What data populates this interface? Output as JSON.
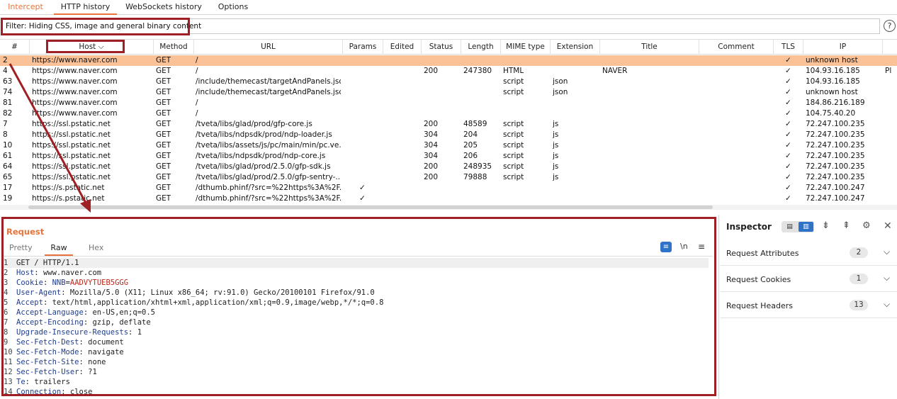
{
  "tabs": [
    {
      "label": "Intercept"
    },
    {
      "label": "HTTP history"
    },
    {
      "label": "WebSockets history"
    },
    {
      "label": "Options"
    }
  ],
  "filter": {
    "text": "Filter: Hiding CSS, image and general binary content",
    "help": "?"
  },
  "columns": {
    "num": "#",
    "host": "Host",
    "method": "Method",
    "url": "URL",
    "params": "Params",
    "edited": "Edited",
    "status": "Status",
    "length": "Length",
    "mime": "MIME type",
    "extension": "Extension",
    "title": "Title",
    "comment": "Comment",
    "tls": "TLS",
    "ip": "IP"
  },
  "rows": [
    {
      "num": "2",
      "host": "https://www.naver.com",
      "method": "GET",
      "url": "/",
      "params": "",
      "status": "",
      "length": "",
      "mime": "",
      "ext": "",
      "title": "",
      "tls": "✓",
      "ip": "unknown host",
      "extra": ""
    },
    {
      "num": "4",
      "host": "https://www.naver.com",
      "method": "GET",
      "url": "/",
      "params": "",
      "status": "200",
      "length": "247380",
      "mime": "HTML",
      "ext": "",
      "title": "NAVER",
      "tls": "✓",
      "ip": "104.93.16.185",
      "extra": "Pl"
    },
    {
      "num": "63",
      "host": "https://www.naver.com",
      "method": "GET",
      "url": "/include/themecast/targetAndPanels.json",
      "params": "",
      "status": "",
      "length": "",
      "mime": "script",
      "ext": "json",
      "title": "",
      "tls": "✓",
      "ip": "104.93.16.185",
      "extra": ""
    },
    {
      "num": "74",
      "host": "https://www.naver.com",
      "method": "GET",
      "url": "/include/themecast/targetAndPanels.json",
      "params": "",
      "status": "",
      "length": "",
      "mime": "script",
      "ext": "json",
      "title": "",
      "tls": "✓",
      "ip": "unknown host",
      "extra": ""
    },
    {
      "num": "81",
      "host": "https://www.naver.com",
      "method": "GET",
      "url": "/",
      "params": "",
      "status": "",
      "length": "",
      "mime": "",
      "ext": "",
      "title": "",
      "tls": "✓",
      "ip": "184.86.216.189",
      "extra": ""
    },
    {
      "num": "82",
      "host": "https://www.naver.com",
      "method": "GET",
      "url": "/",
      "params": "",
      "status": "",
      "length": "",
      "mime": "",
      "ext": "",
      "title": "",
      "tls": "✓",
      "ip": "104.75.40.20",
      "extra": ""
    },
    {
      "num": "7",
      "host": "https://ssl.pstatic.net",
      "method": "GET",
      "url": "/tveta/libs/glad/prod/gfp-core.js",
      "params": "",
      "status": "200",
      "length": "48589",
      "mime": "script",
      "ext": "js",
      "title": "",
      "tls": "✓",
      "ip": "72.247.100.235",
      "extra": ""
    },
    {
      "num": "8",
      "host": "https://ssl.pstatic.net",
      "method": "GET",
      "url": "/tveta/libs/ndpsdk/prod/ndp-loader.js",
      "params": "",
      "status": "304",
      "length": "204",
      "mime": "script",
      "ext": "js",
      "title": "",
      "tls": "✓",
      "ip": "72.247.100.235",
      "extra": ""
    },
    {
      "num": "10",
      "host": "https://ssl.pstatic.net",
      "method": "GET",
      "url": "/tveta/libs/assets/js/pc/main/min/pc.ve...",
      "params": "",
      "status": "304",
      "length": "205",
      "mime": "script",
      "ext": "js",
      "title": "",
      "tls": "✓",
      "ip": "72.247.100.235",
      "extra": ""
    },
    {
      "num": "61",
      "host": "https://ssl.pstatic.net",
      "method": "GET",
      "url": "/tveta/libs/ndpsdk/prod/ndp-core.js",
      "params": "",
      "status": "304",
      "length": "206",
      "mime": "script",
      "ext": "js",
      "title": "",
      "tls": "✓",
      "ip": "72.247.100.235",
      "extra": ""
    },
    {
      "num": "64",
      "host": "https://ssl.pstatic.net",
      "method": "GET",
      "url": "/tveta/libs/glad/prod/2.5.0/gfp-sdk.js",
      "params": "",
      "status": "200",
      "length": "248935",
      "mime": "script",
      "ext": "js",
      "title": "",
      "tls": "✓",
      "ip": "72.247.100.235",
      "extra": ""
    },
    {
      "num": "65",
      "host": "https://ssl.pstatic.net",
      "method": "GET",
      "url": "/tveta/libs/glad/prod/2.5.0/gfp-sentry-...",
      "params": "",
      "status": "200",
      "length": "79888",
      "mime": "script",
      "ext": "js",
      "title": "",
      "tls": "✓",
      "ip": "72.247.100.235",
      "extra": ""
    },
    {
      "num": "17",
      "host": "https://s.pstatic.net",
      "method": "GET",
      "url": "/dthumb.phinf/?src=%22https%3A%2F...",
      "params": "✓",
      "status": "",
      "length": "",
      "mime": "",
      "ext": "",
      "title": "",
      "tls": "✓",
      "ip": "72.247.100.247",
      "extra": ""
    },
    {
      "num": "19",
      "host": "https://s.pstatic.net",
      "method": "GET",
      "url": "/dthumb.phinf/?src=%22https%3A%2F...",
      "params": "✓",
      "status": "",
      "length": "",
      "mime": "",
      "ext": "",
      "title": "",
      "tls": "✓",
      "ip": "72.247.100.247",
      "extra": ""
    }
  ],
  "request": {
    "title": "Request",
    "tabs": [
      "Pretty",
      "Raw",
      "Hex"
    ],
    "newline_label": "\\n",
    "lines": [
      {
        "n": "1",
        "k": "",
        "sep": "",
        "v": "GET / HTTP/1.1"
      },
      {
        "n": "2",
        "k": "Host",
        "sep": ": ",
        "v": "www.naver.com"
      },
      {
        "n": "3",
        "k": "Cookie",
        "sep": ": ",
        "v": "",
        "cookie_name": "NNB",
        "cookie_value": "AADVYTUEB5GGG"
      },
      {
        "n": "4",
        "k": "User-Agent",
        "sep": ": ",
        "v": "Mozilla/5.0 (X11; Linux x86_64; rv:91.0) Gecko/20100101 Firefox/91.0"
      },
      {
        "n": "5",
        "k": "Accept",
        "sep": ": ",
        "v": "text/html,application/xhtml+xml,application/xml;q=0.9,image/webp,*/*;q=0.8"
      },
      {
        "n": "6",
        "k": "Accept-Language",
        "sep": ": ",
        "v": "en-US,en;q=0.5"
      },
      {
        "n": "7",
        "k": "Accept-Encoding",
        "sep": ": ",
        "v": "gzip, deflate"
      },
      {
        "n": "8",
        "k": "Upgrade-Insecure-Requests",
        "sep": ": ",
        "v": "1"
      },
      {
        "n": "9",
        "k": "Sec-Fetch-Dest",
        "sep": ": ",
        "v": "document"
      },
      {
        "n": "10",
        "k": "Sec-Fetch-Mode",
        "sep": ": ",
        "v": "navigate"
      },
      {
        "n": "11",
        "k": "Sec-Fetch-Site",
        "sep": ": ",
        "v": "none"
      },
      {
        "n": "12",
        "k": "Sec-Fetch-User",
        "sep": ": ",
        "v": "?1"
      },
      {
        "n": "13",
        "k": "Te",
        "sep": ": ",
        "v": "trailers"
      },
      {
        "n": "14",
        "k": "Connection",
        "sep": ": ",
        "v": "close"
      }
    ]
  },
  "inspector": {
    "title": "Inspector",
    "sections": [
      {
        "label": "Request Attributes",
        "count": "2"
      },
      {
        "label": "Request Cookies",
        "count": "1"
      },
      {
        "label": "Request Headers",
        "count": "13"
      }
    ]
  },
  "colors": {
    "accent": "#e8743b",
    "selected_row": "#fbc197",
    "annotation": "#a01f25",
    "toggle_blue": "#2f73c8"
  }
}
